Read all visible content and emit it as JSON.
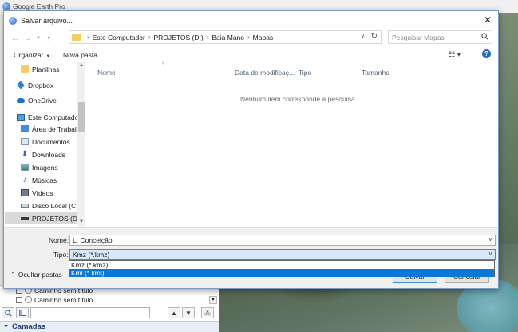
{
  "app": {
    "title": "Google Earth Pro"
  },
  "places": {
    "items": [
      {
        "label": "Caminho sem título"
      },
      {
        "label": "Caminho sem título"
      }
    ]
  },
  "layers": {
    "label": "Camadas"
  },
  "dialog": {
    "title": "Salvar arquivo...",
    "close_symbol": "✕",
    "breadcrumbs": [
      "Este Computador",
      "PROJETOS (D:)",
      "Baia Mano",
      "Mapas"
    ],
    "search_placeholder": "Pesquisar Mapas",
    "toolbar": {
      "organize_label": "Organizar",
      "new_folder_label": "Nova pasta"
    },
    "nav": [
      {
        "label": "Planilhas",
        "icon": "folder-icon"
      },
      {
        "label": "Dropbox",
        "icon": "dropbox-icon"
      },
      {
        "label": "OneDrive",
        "icon": "onedrive-icon"
      },
      {
        "label": "Este Computador",
        "icon": "computer-icon"
      },
      {
        "label": "Área de Trabalho",
        "icon": "desktop-icon"
      },
      {
        "label": "Documentos",
        "icon": "documents-icon"
      },
      {
        "label": "Downloads",
        "icon": "download-icon"
      },
      {
        "label": "Imagens",
        "icon": "pictures-icon"
      },
      {
        "label": "Músicas",
        "icon": "music-icon"
      },
      {
        "label": "Vídeos",
        "icon": "videos-icon"
      },
      {
        "label": "Disco Local (C:)",
        "icon": "disk-icon"
      },
      {
        "label": "PROJETOS (D:)",
        "icon": "drive-icon",
        "selected": true
      }
    ],
    "columns": [
      "Nome",
      "Data de modificaç...",
      "Tipo",
      "Tamanho"
    ],
    "empty_message": "Nenhum item corresponde à pesquisa.",
    "form": {
      "name_label": "Nome:",
      "name_value": "L. Conceição",
      "type_label": "Tipo:",
      "type_value": "Kmz (*.kmz)",
      "type_options": [
        "Kmz (*.kmz)",
        "Kml (*.kml)"
      ],
      "type_highlighted": "Kml (*.kml)",
      "hide_folders_label": "Ocultar pastas",
      "save_label": "Salvar",
      "cancel_label": "Cancelar"
    }
  }
}
